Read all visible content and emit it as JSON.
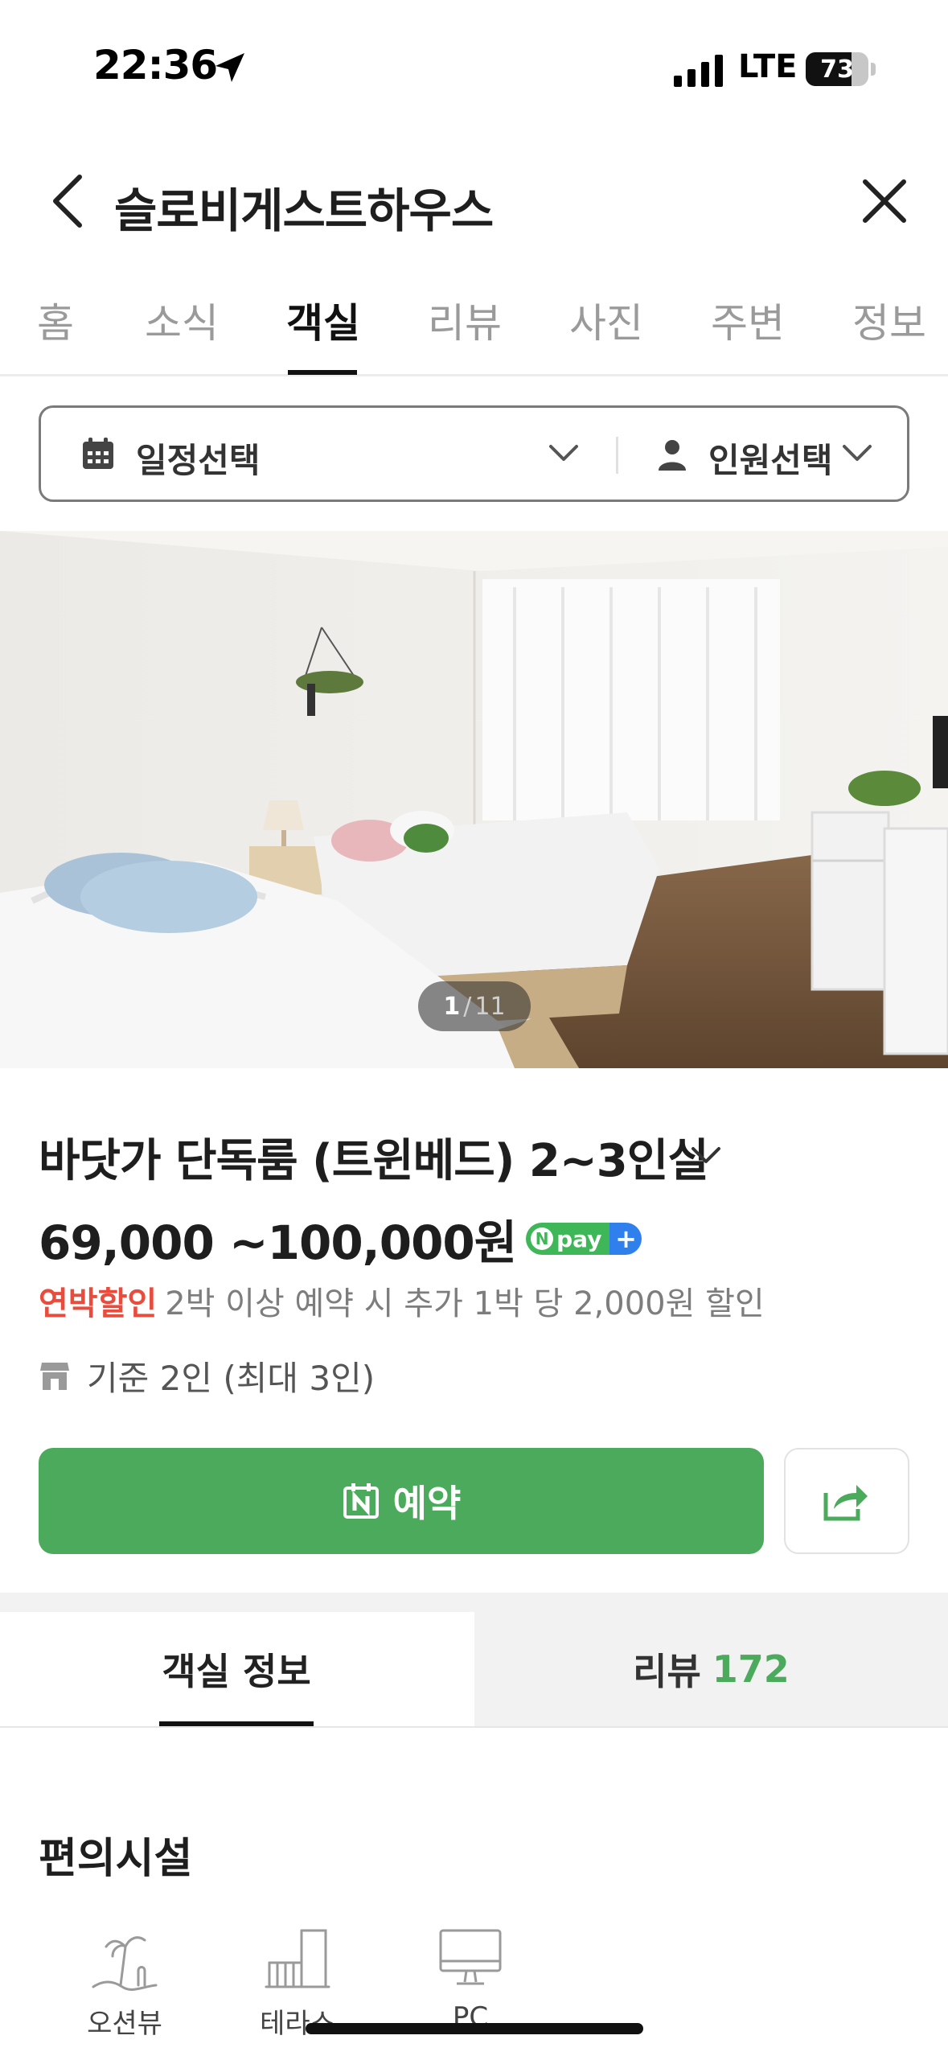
{
  "status_bar": {
    "time": "22:36",
    "network": "LTE",
    "battery": "73",
    "battery_level": 0.73
  },
  "nav": {
    "title": "슬로비게스트하우스",
    "back_icon": "chevron-left-icon",
    "close_icon": "close-icon"
  },
  "tabs": [
    {
      "label": "홈",
      "active": false
    },
    {
      "label": "소식",
      "active": false
    },
    {
      "label": "객실",
      "active": true
    },
    {
      "label": "리뷰",
      "active": false
    },
    {
      "label": "사진",
      "active": false
    },
    {
      "label": "주변",
      "active": false
    },
    {
      "label": "정보",
      "active": false
    }
  ],
  "selector": {
    "date_label": "일정선택",
    "guest_label": "인원선택"
  },
  "photo": {
    "current": "1",
    "separator": "/",
    "total": "11"
  },
  "room": {
    "name": "바닷가 단독룸 (트윈베드) 2~3인실",
    "price": "69,000 ~100,000원",
    "npay": "pay",
    "npay_n": "N",
    "npay_plus": "+",
    "discount_tag": "연박할인",
    "discount_text": "2박 이상 예약 시 추가 1박 당 2,000원 할인",
    "capacity": "기준 2인 (최대 3인)"
  },
  "actions": {
    "reserve_label": "예약",
    "share_icon": "share-icon"
  },
  "section_tabs": {
    "room_info": "객실 정보",
    "review_label": "리뷰",
    "review_count": "172"
  },
  "amenities": {
    "title": "편의시설",
    "items": [
      {
        "label": "오션뷰",
        "icon": "ocean-view-icon"
      },
      {
        "label": "테라스",
        "icon": "terrace-icon"
      },
      {
        "label": "PC",
        "icon": "pc-icon"
      }
    ]
  },
  "colors": {
    "accent_green": "#4caa5c",
    "discount_red": "#e94b3c",
    "npay_blue": "#2f80ed"
  }
}
